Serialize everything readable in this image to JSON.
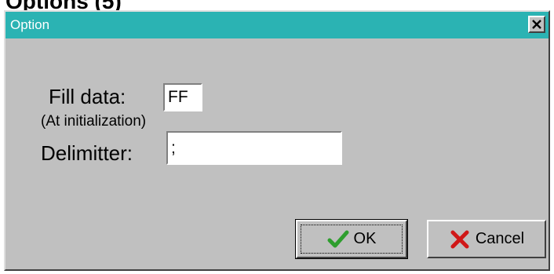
{
  "page": {
    "heading": "Options (5)"
  },
  "dialog": {
    "title": "Option",
    "close_icon": "close-x-icon",
    "fill_data_label": "Fill data:",
    "fill_data_value": "FF",
    "init_note": "(At initialization)",
    "delimiter_label": "Delimitter:",
    "delimiter_value": ";",
    "ok_label": "OK",
    "ok_icon": "checkmark-icon",
    "cancel_label": "Cancel",
    "cancel_icon": "red-x-icon"
  },
  "colors": {
    "titlebar": "#2bb3b3",
    "dialog_face": "#c0c0c0",
    "ok_check": "#2e9e2e",
    "cancel_x": "#d01818"
  }
}
